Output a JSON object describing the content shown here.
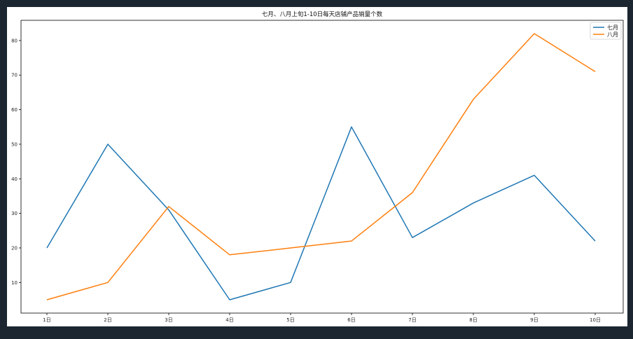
{
  "chart_data": {
    "type": "line",
    "title": "七月、八月上旬1-10日每天店铺产品销量个数",
    "xlabel": "",
    "ylabel": "",
    "categories": [
      "1日",
      "2日",
      "3日",
      "4日",
      "5日",
      "6日",
      "7日",
      "8日",
      "9日",
      "10日"
    ],
    "series": [
      {
        "name": "七月",
        "color": "#1f77b4",
        "values": [
          20,
          50,
          31,
          5,
          10,
          55,
          23,
          33,
          41,
          22
        ]
      },
      {
        "name": "八月",
        "color": "#ff7f0e",
        "values": [
          5,
          10,
          32,
          18,
          20,
          22,
          36,
          63,
          82,
          71
        ]
      }
    ],
    "yticks": [
      10,
      20,
      30,
      40,
      50,
      60,
      70,
      80
    ],
    "ylim": [
      1.15,
      85.85
    ],
    "grid": false,
    "legend": "top-right"
  }
}
